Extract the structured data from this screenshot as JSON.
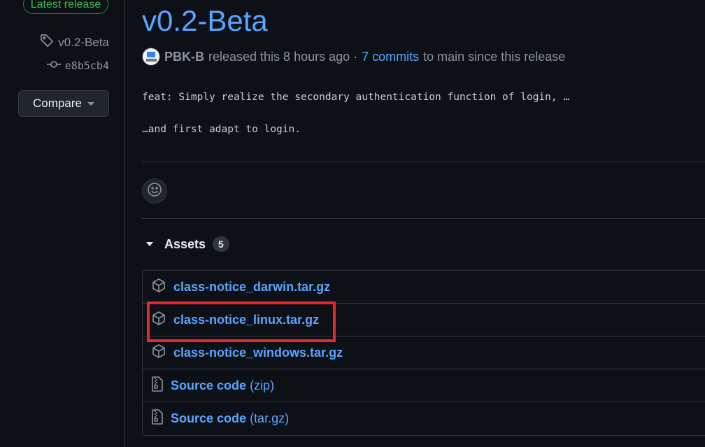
{
  "sidebar": {
    "latest_badge": "Latest release",
    "tag": "v0.2-Beta",
    "commit": "e8b5cb4",
    "compare_label": "Compare"
  },
  "release": {
    "title": "v0.2-Beta",
    "author": "PBK-B",
    "released_text": "released this 8 hours ago ·",
    "commits_link": "7 commits",
    "since_text": "to main since this release",
    "message_line1": "feat: Simply realize the secondary authentication function of login, …",
    "message_line2": "…and first adapt to login."
  },
  "assets": {
    "heading": "Assets",
    "count": "5",
    "items": [
      {
        "name": "class-notice_darwin.tar.gz",
        "suffix": "",
        "icon": "package-icon"
      },
      {
        "name": "class-notice_linux.tar.gz",
        "suffix": "",
        "icon": "package-icon"
      },
      {
        "name": "class-notice_windows.tar.gz",
        "suffix": "",
        "icon": "package-icon"
      },
      {
        "name": "Source code",
        "suffix": "(zip)",
        "icon": "file-zip-icon"
      },
      {
        "name": "Source code",
        "suffix": "(tar.gz)",
        "icon": "file-zip-icon"
      }
    ]
  },
  "colors": {
    "background": "#0d1117",
    "link": "#58a6ff",
    "highlight": "#e5262b",
    "latest_green": "#3fb950"
  }
}
